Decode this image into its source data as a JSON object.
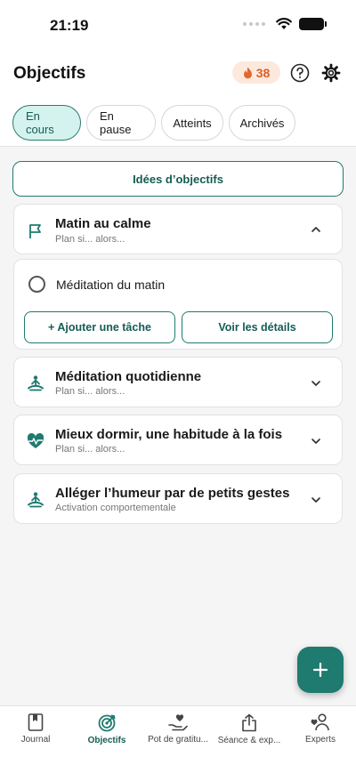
{
  "status_bar": {
    "time": "21:19"
  },
  "header": {
    "title": "Objectifs",
    "streak_count": "38"
  },
  "tabs": [
    {
      "label": "En cours",
      "active": true
    },
    {
      "label": "En pause",
      "active": false
    },
    {
      "label": "Atteints",
      "active": false
    },
    {
      "label": "Archivés",
      "active": false
    }
  ],
  "ideas_button": {
    "label": "Idées d’objectifs"
  },
  "goals": [
    {
      "title": "Matin au calme",
      "subtitle": "Plan si... alors...",
      "icon": "flag-icon",
      "expanded": true
    },
    {
      "title": "Méditation quotidienne",
      "subtitle": "Plan si... alors...",
      "icon": "meditation-icon",
      "expanded": false
    },
    {
      "title": "Mieux dormir, une habitude à la fois",
      "subtitle": "Plan si... alors...",
      "icon": "heartbeat-icon",
      "expanded": false
    },
    {
      "title": "Alléger l’humeur par de petits gestes",
      "subtitle": "Activation comportementale",
      "icon": "meditation-icon",
      "expanded": false
    }
  ],
  "expanded_goal": {
    "task": "Méditation du matin",
    "add_task_label": "+ Ajouter une tâche",
    "details_label": "Voir les détails"
  },
  "bottom_nav": [
    {
      "label": "Journal",
      "icon": "journal-icon",
      "active": false
    },
    {
      "label": "Objectifs",
      "icon": "target-icon",
      "active": true
    },
    {
      "label": "Pot de gratitu...",
      "icon": "gratitude-jar-icon",
      "active": false
    },
    {
      "label": "Séance & exp...",
      "icon": "share-icon",
      "active": false
    },
    {
      "label": "Experts",
      "icon": "experts-icon",
      "active": false
    }
  ],
  "colors": {
    "accent": "#1f7a6f",
    "accent_light": "#d4f3ee",
    "streak_bg": "#fde8dc",
    "streak_fg": "#d9602a"
  }
}
